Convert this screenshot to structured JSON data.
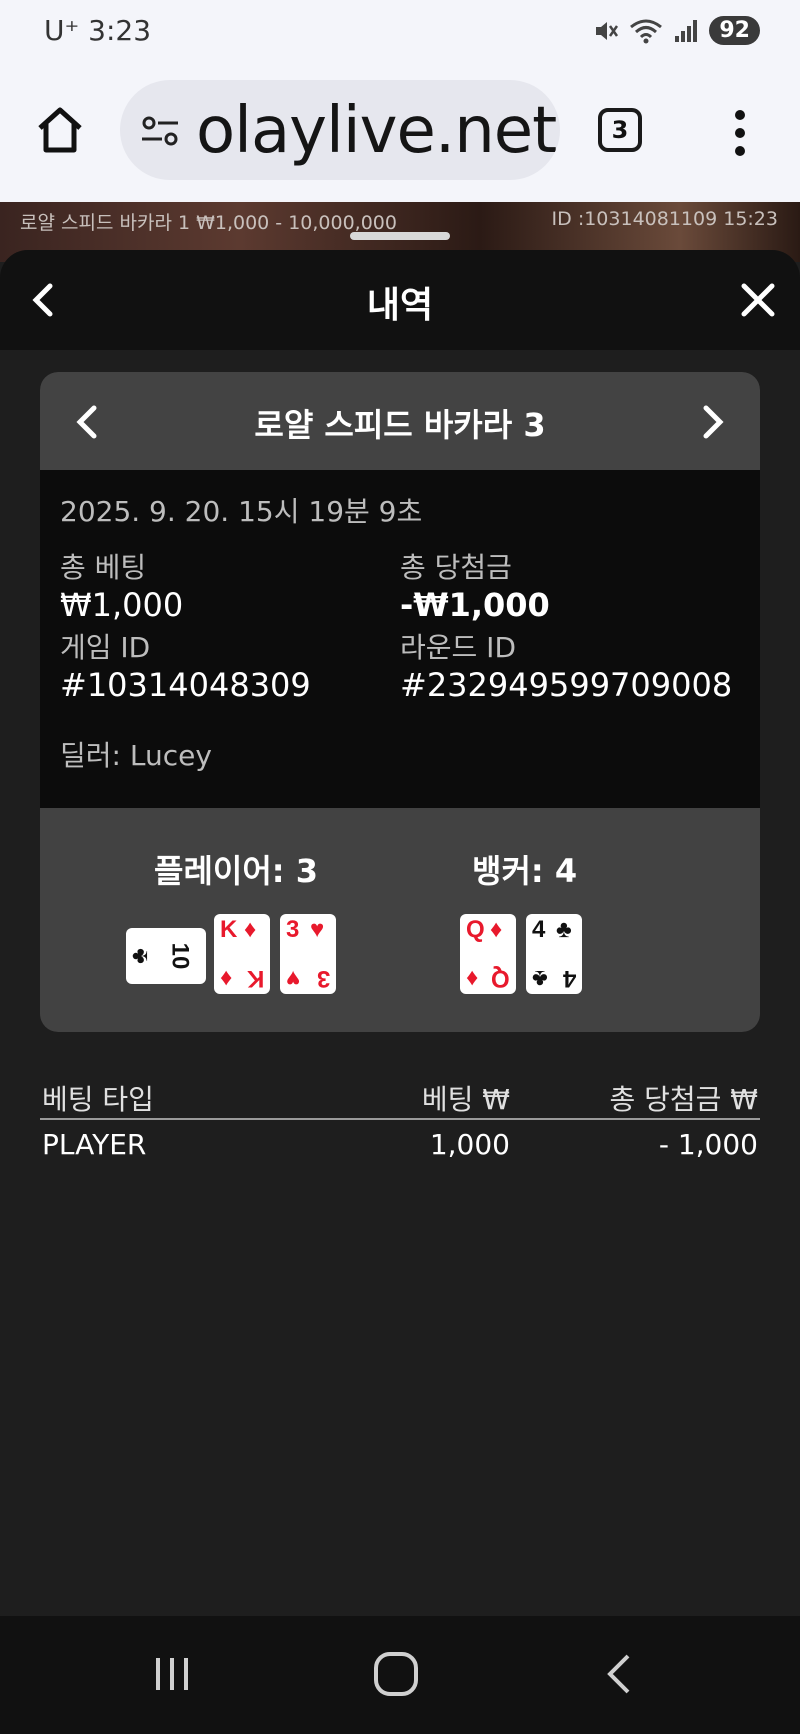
{
  "status_bar": {
    "carrier_time": "U⁺ 3:23",
    "battery": "92"
  },
  "browser": {
    "url": "olaylive.net",
    "tabs_count": "3"
  },
  "video": {
    "left_text": "로얄 스피드 바카라 1 ₩1,000 - 10,000,000",
    "right_text": "ID :10314081109 15:23"
  },
  "sheet": {
    "title": "내역"
  },
  "card": {
    "title": "로얄 스피드 바카라 3",
    "datetime": "2025. 9. 20. 15시 19분 9초",
    "total_bet_label": "총 베팅",
    "total_bet_value": "₩1,000",
    "total_win_label": "총 당첨금",
    "total_win_value": "-₩1,000",
    "game_id_label": "게임 ID",
    "game_id_value": "#10314048309",
    "round_id_label": "라운드 ID",
    "round_id_value": "#232949599709008",
    "dealer": "딜러: Lucey",
    "player_label": "플레이어: 3",
    "banker_label": "뱅커: 4",
    "player_cards": [
      {
        "rank": "10",
        "suit": "♣",
        "color": "#111111"
      },
      {
        "rank": "K",
        "suit": "♦",
        "color": "#e8192c"
      },
      {
        "rank": "3",
        "suit": "♥",
        "color": "#e8192c"
      }
    ],
    "banker_cards": [
      {
        "rank": "Q",
        "suit": "♦",
        "color": "#e8192c"
      },
      {
        "rank": "4",
        "suit": "♣",
        "color": "#111111"
      }
    ]
  },
  "bet_table": {
    "headers": [
      "베팅 타입",
      "베팅 ₩",
      "총 당첨금 ₩"
    ],
    "rows": [
      {
        "type": "PLAYER",
        "bet": "1,000",
        "win": "- 1,000"
      }
    ]
  }
}
